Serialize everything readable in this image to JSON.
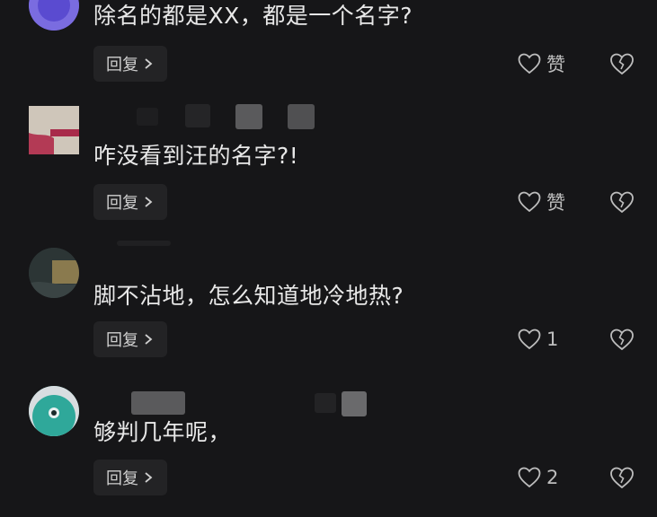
{
  "comments": [
    {
      "text": "除名的都是XX，都是一个名字?",
      "reply_label": "回复",
      "like_label": "赞",
      "avatar_color": "#6a5acd"
    },
    {
      "text": "咋没看到汪的名字?!",
      "reply_label": "回复",
      "like_label": "赞",
      "avatar_color": "#d8cfc4"
    },
    {
      "text": "脚不沾地，怎么知道地冷地热?",
      "reply_label": "回复",
      "like_label": "1",
      "avatar_color": "#2d3a3a"
    },
    {
      "text": "够判几年呢，",
      "reply_label": "回复",
      "like_label": "2",
      "avatar_color": "#2fa89a"
    }
  ],
  "colors": {
    "background": "#161618",
    "text": "#e8e8e8",
    "button_bg": "#232325",
    "icon": "#cfcfcf"
  },
  "icons": {
    "like": "heart-outline-icon",
    "dislike": "broken-heart-icon",
    "reply_chevron": "chevron-right-icon"
  }
}
